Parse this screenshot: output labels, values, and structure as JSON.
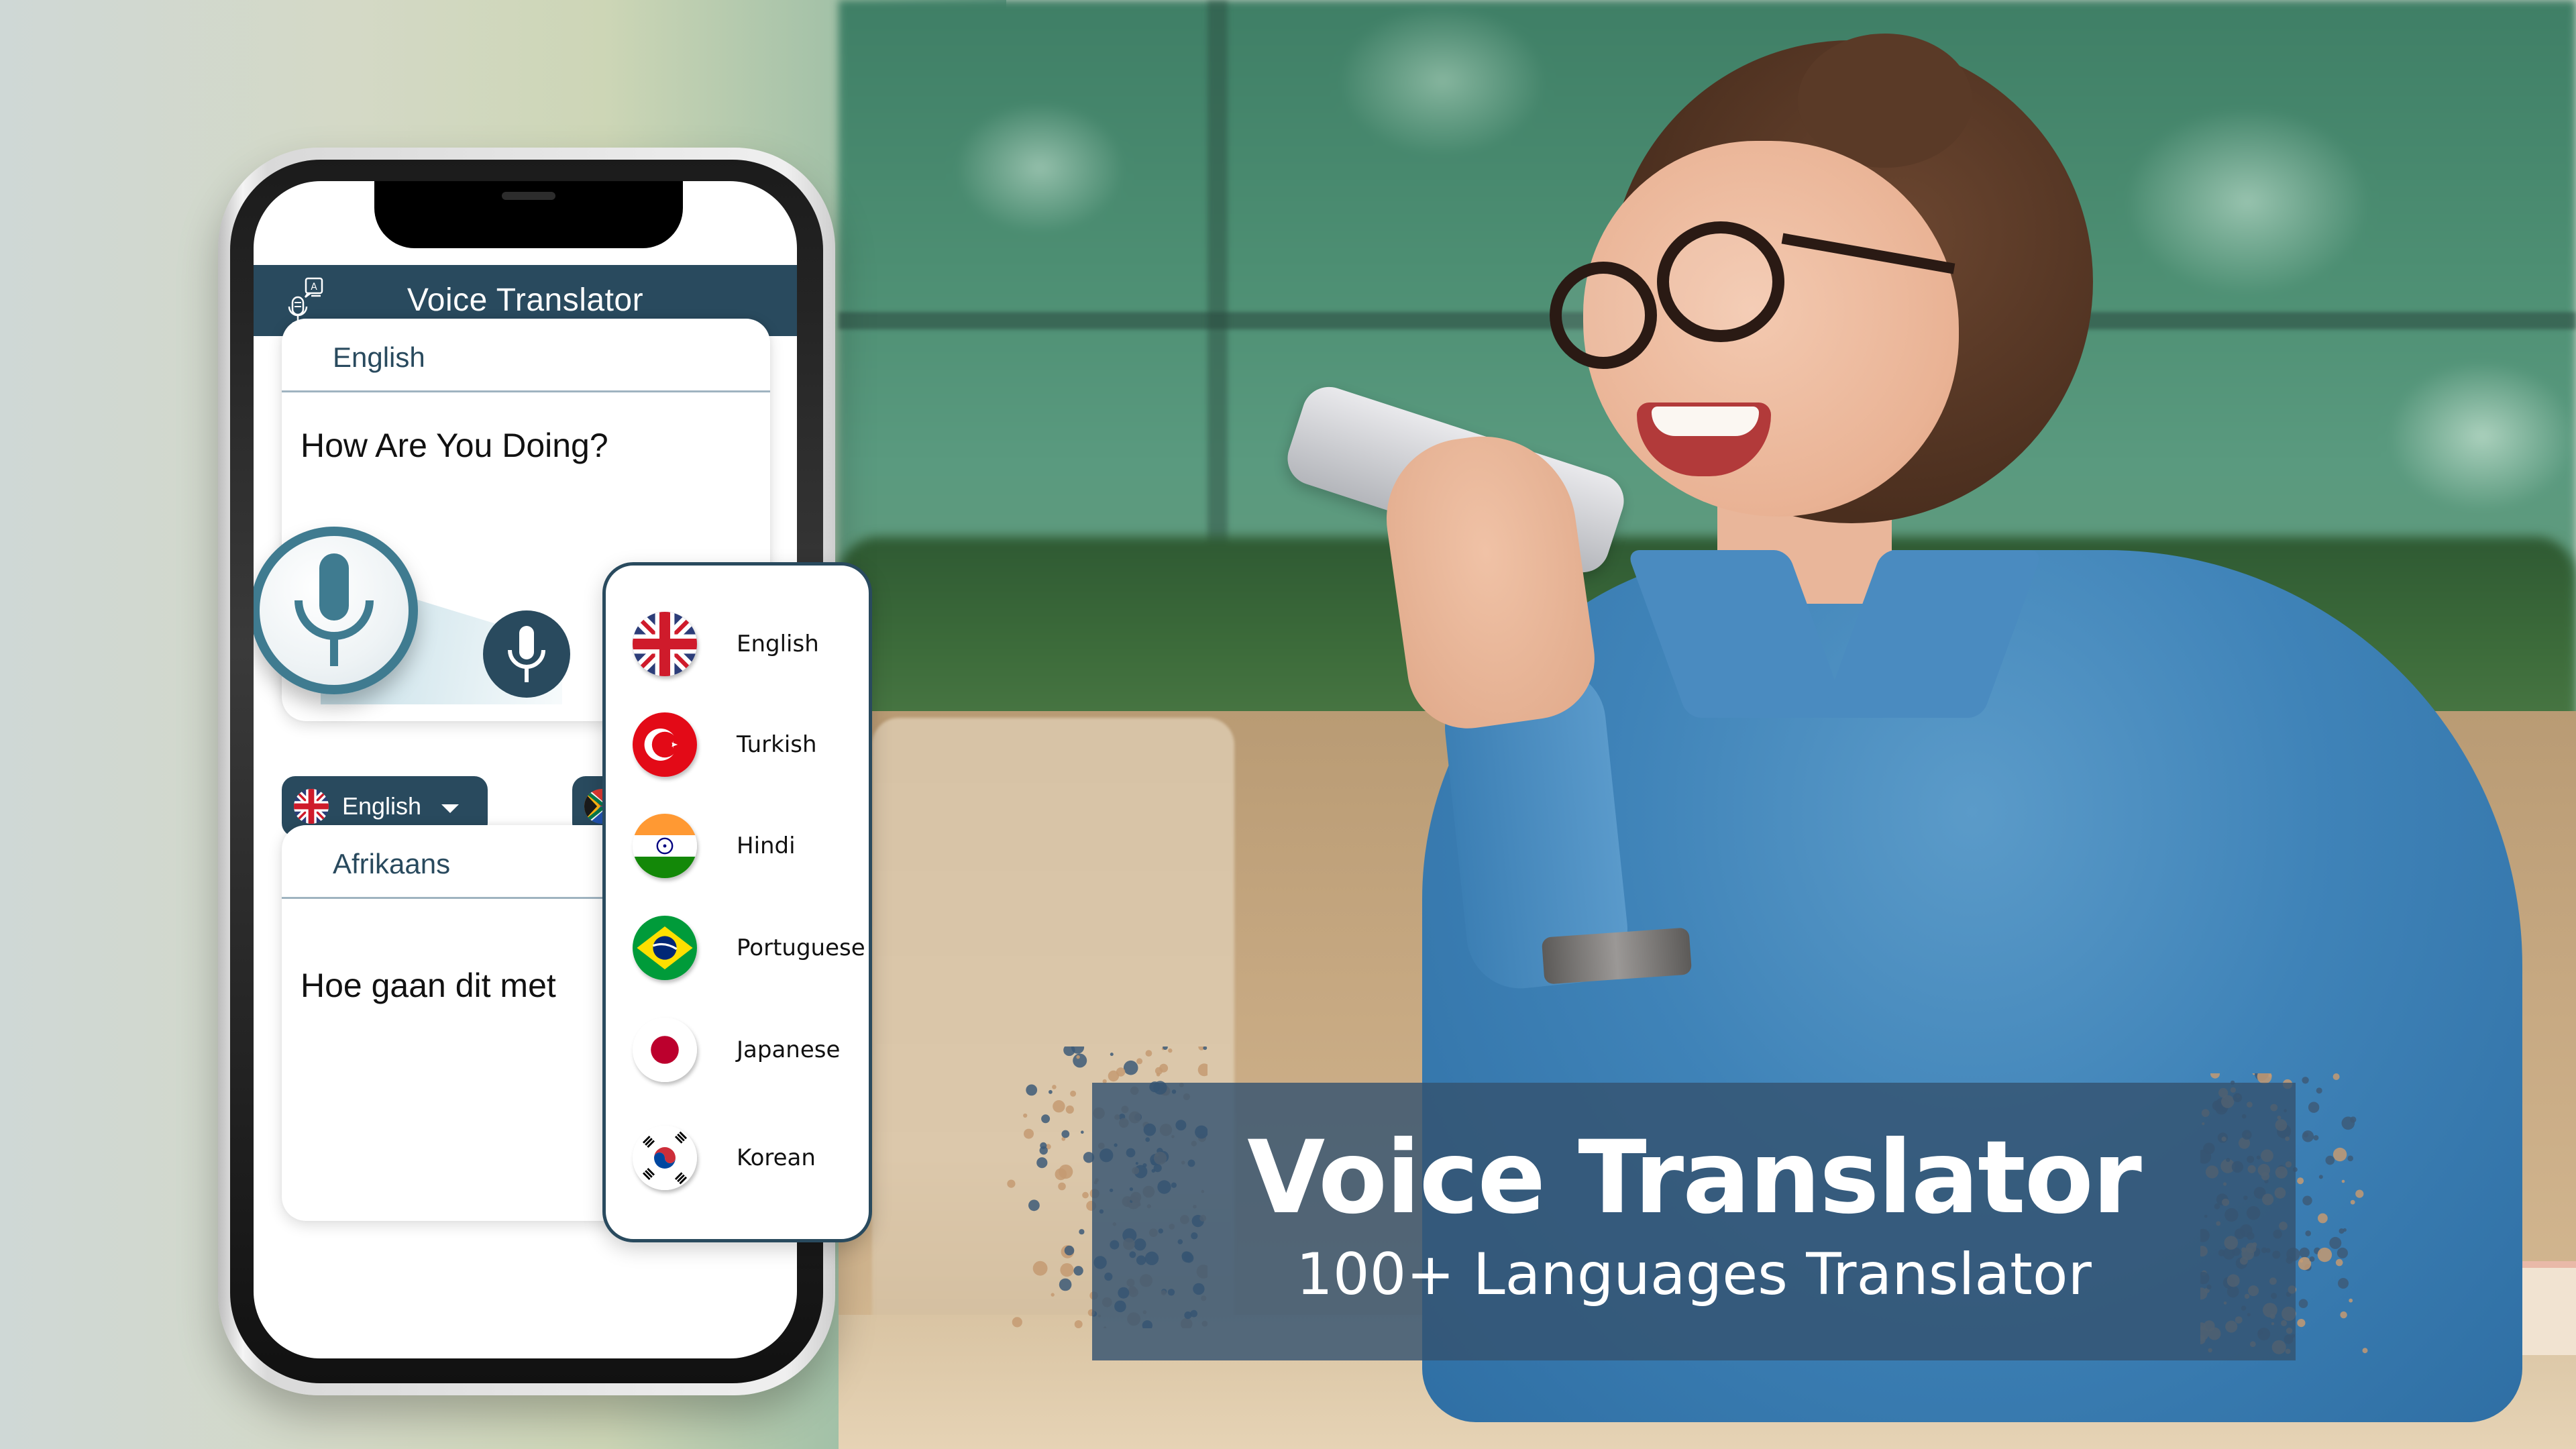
{
  "banner": {
    "title": "Voice Translator",
    "subtitle": "100+ Languages Translator"
  },
  "app": {
    "title": "Voice Translator",
    "logo_icon": "mic-translate-icon",
    "source": {
      "language": "English",
      "text": "How Are You Doing?"
    },
    "target": {
      "language": "Afrikaans",
      "text": "Hoe gaan dit met"
    },
    "source_chip": {
      "label": "English",
      "flag": "uk-flag-icon"
    },
    "target_chip": {
      "flag": "south-africa-flag-icon"
    },
    "mic_icon": "microphone-icon"
  },
  "language_dropdown": {
    "items": [
      {
        "label": "English",
        "flag": "uk-flag-icon"
      },
      {
        "label": "Turkish",
        "flag": "turkey-flag-icon"
      },
      {
        "label": "Hindi",
        "flag": "india-flag-icon"
      },
      {
        "label": "Portuguese",
        "flag": "brazil-flag-icon"
      },
      {
        "label": "Japanese",
        "flag": "japan-flag-icon"
      },
      {
        "label": "Korean",
        "flag": "korea-flag-icon"
      }
    ]
  },
  "colors": {
    "primary": "#294a5e",
    "mic_ring": "#3f7b90",
    "banner_bg": "#345370",
    "text_dark": "#111111"
  }
}
